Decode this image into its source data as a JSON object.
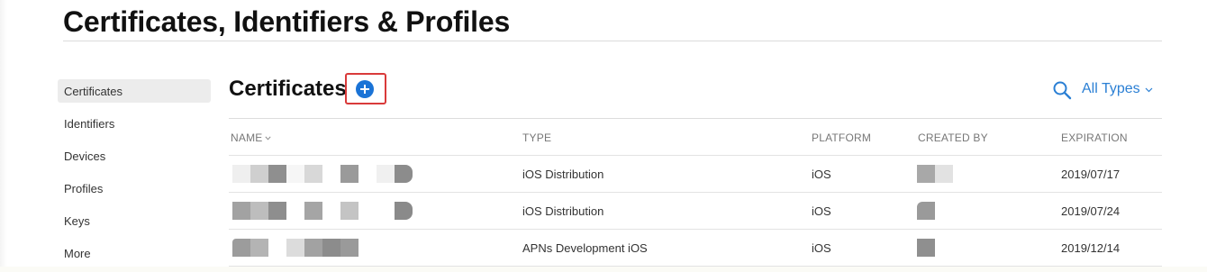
{
  "page": {
    "title": "Certificates, Identifiers & Profiles"
  },
  "sidebar": {
    "items": [
      {
        "label": "Certificates",
        "active": true
      },
      {
        "label": "Identifiers"
      },
      {
        "label": "Devices"
      },
      {
        "label": "Profiles"
      },
      {
        "label": "Keys"
      },
      {
        "label": "More"
      }
    ]
  },
  "main": {
    "title": "Certificates",
    "add_icon": "plus-circle-icon",
    "search_icon": "search-icon",
    "filter_label": "All Types",
    "accent_color": "#1a73d6",
    "highlight_color": "#d93a3a"
  },
  "table": {
    "columns": {
      "name": "NAME",
      "type": "TYPE",
      "platform": "PLATFORM",
      "created_by": "CREATED BY",
      "expiration": "EXPIRATION"
    },
    "rows": [
      {
        "name": "",
        "type": "iOS Distribution",
        "platform": "iOS",
        "created_by": "",
        "expiration": "2019/07/17"
      },
      {
        "name": "",
        "type": "iOS Distribution",
        "platform": "iOS",
        "created_by": "",
        "expiration": "2019/07/24"
      },
      {
        "name": "",
        "type": "APNs Development iOS",
        "platform": "iOS",
        "created_by": "",
        "expiration": "2019/12/14"
      }
    ]
  }
}
